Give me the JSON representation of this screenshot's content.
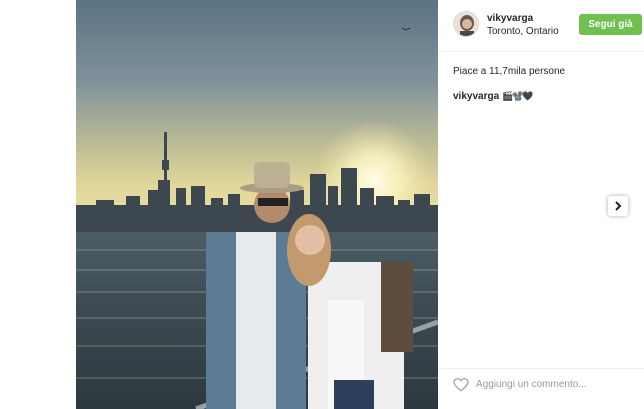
{
  "post": {
    "username": "vikyvarga",
    "location": "Toronto, Ontario",
    "follow_label": "Segui già",
    "likes_text": "Piace a 11,7mila persone",
    "caption_user": "vikyvarga",
    "caption_text": "🎬📽️🖤",
    "comment_placeholder": "Aggiungi un commento..."
  },
  "icons": {
    "avatar": "avatar",
    "like": "heart-icon",
    "next": "chevron-right-icon"
  },
  "colors": {
    "follow_button": "#70c050",
    "text": "#262626",
    "placeholder": "#999999"
  }
}
